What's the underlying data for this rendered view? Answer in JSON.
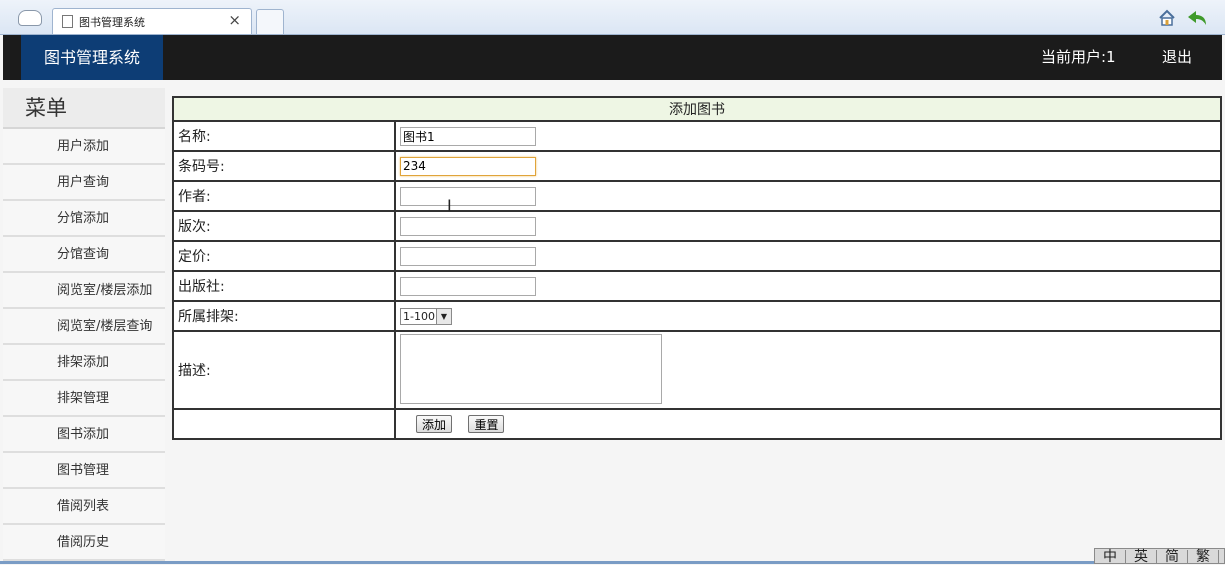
{
  "browser": {
    "tab_title": "图书管理系统",
    "tab_close": "×"
  },
  "header": {
    "brand": "图书管理系统",
    "current_user": "当前用户:1",
    "logout": "退出"
  },
  "sidebar": {
    "title": "菜单",
    "items": [
      {
        "label": "用户添加"
      },
      {
        "label": "用户查询"
      },
      {
        "label": "分馆添加"
      },
      {
        "label": "分馆查询"
      },
      {
        "label": "阅览室/楼层添加"
      },
      {
        "label": "阅览室/楼层查询"
      },
      {
        "label": "排架添加"
      },
      {
        "label": "排架管理"
      },
      {
        "label": "图书添加"
      },
      {
        "label": "图书管理"
      },
      {
        "label": "借阅列表"
      },
      {
        "label": "借阅历史"
      }
    ]
  },
  "form": {
    "title": "添加图书",
    "fields": {
      "name": {
        "label": "名称:",
        "value": "图书1"
      },
      "barcode": {
        "label": "条码号:",
        "value": "234"
      },
      "author": {
        "label": "作者:",
        "value": ""
      },
      "edition": {
        "label": "版次:",
        "value": ""
      },
      "price": {
        "label": "定价:",
        "value": ""
      },
      "publisher": {
        "label": "出版社:",
        "value": ""
      },
      "shelf": {
        "label": "所属排架:",
        "selected": "1-100"
      },
      "description": {
        "label": "描述:",
        "value": ""
      }
    },
    "add_button": "添加",
    "reset_button": "重置"
  },
  "ime": [
    "中",
    "英",
    "简",
    "繁"
  ],
  "colors": {
    "header_bg": "#1b1b1b",
    "brand_bg": "#0d3d75",
    "form_head_bg": "#eef6e4",
    "focus_border": "#e0a43a"
  }
}
